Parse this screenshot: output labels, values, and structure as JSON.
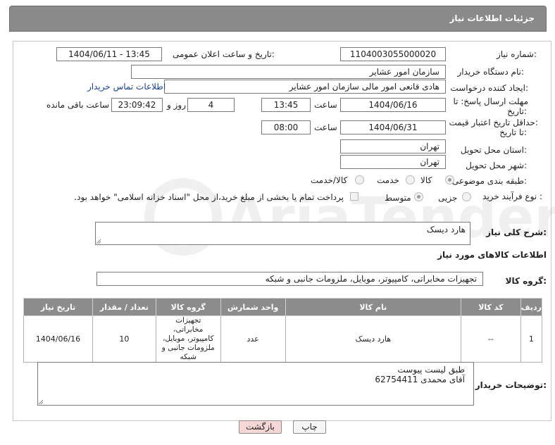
{
  "header": {
    "title": "جزئیات اطلاعات نیاز"
  },
  "form": {
    "need_number_label": "شماره نیاز:",
    "need_number": "1104003055000020",
    "announce_label": "تاریخ و ساعت اعلان عمومی:",
    "announce_value": "1404/06/11 - 13:45",
    "buyer_org_label": "نام دستگاه خریدار:",
    "buyer_org": "سازمان امور عشایر",
    "creator_label": "ایجاد کننده درخواست:",
    "creator": "هادی قانعی امور مالی سازمان امور عشایر",
    "buyer_contact_link": "اطلاعات تماس خریدار",
    "deadline_label_1": "مهلت ارسال پاسخ: تا",
    "deadline_label_2": "تاریخ:",
    "deadline_date": "1404/06/16",
    "time_label": "ساعت",
    "deadline_time": "13:45",
    "days_value": "4",
    "days_label": "روز و",
    "remaining_time": "23:09:42",
    "remaining_label": "ساعت باقی مانده",
    "price_validity_label_1": "حداقل تاریخ اعتبار قیمت:",
    "price_validity_label_2": "تا تاریخ:",
    "price_validity_date": "1404/06/31",
    "price_validity_time": "08:00",
    "delivery_province_label": "استان محل تحویل:",
    "delivery_province": "تهران",
    "delivery_city_label": "شهر محل تحویل:",
    "delivery_city": "تهران",
    "category_label": "طبقه بندی موضوعی:",
    "category_options": [
      "کالا",
      "خدمت",
      "کالا/خدمت"
    ],
    "process_label": "نوع فرآیند خرید :",
    "process_options": [
      "جزیی",
      "متوسط"
    ],
    "payment_note": "پرداخت تمام یا بخشی از مبلغ خرید،از محل \"اسناد خزانه اسلامی\" خواهد بود.",
    "description_label": "شرح کلی نیاز:",
    "description": "هارد دیسک",
    "goods_info_title": "اطلاعات کالاهای مورد نیاز",
    "goods_group_label": "گروه کالا:",
    "goods_group": "تجهیزات مخابراتی، کامپیوتر، موبایل، ملزومات جانبی و شبکه",
    "buyer_notes_label": "توضیحات خریدار:",
    "buyer_notes": "طبق لیست پیوست\nآقای محمدی 62754411"
  },
  "table": {
    "columns": [
      "ردیف",
      "کد کالا",
      "نام کالا",
      "واحد شمارش",
      "گروه کالا",
      "تعداد / مقدار",
      "تاریخ نیاز"
    ],
    "rows": [
      [
        "1",
        "--",
        "هارد دیسک",
        "عدد",
        "تجهیزات مخابراتی، کامپیوتر، موبایل، ملزومات جانبی و شبکه",
        "10",
        "1404/06/16"
      ]
    ]
  },
  "buttons": {
    "print": "چاپ",
    "back": "بازگشت"
  },
  "watermark": {
    "text": "AriaTender.net"
  },
  "colors": {
    "header_bg": "#8a8a8a",
    "table_header_bg": "#8c8c8c",
    "link": "#1a3f9c",
    "back_button_bg": "#f7d6d6"
  }
}
